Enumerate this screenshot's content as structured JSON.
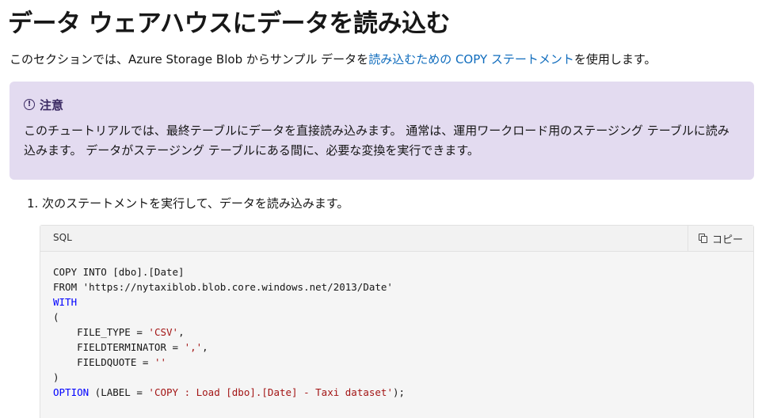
{
  "heading": "データ ウェアハウスにデータを読み込む",
  "intro": {
    "before_link": "このセクションでは、Azure Storage Blob からサンプル データを",
    "link": "読み込むための COPY ステートメント",
    "after_link": "を使用します。"
  },
  "note": {
    "icon": "info-circle-icon",
    "title": "注意",
    "body": "このチュートリアルでは、最終テーブルにデータを直接読み込みます。 通常は、運用ワークロード用のステージング テーブルに読み込みます。 データがステージング テーブルにある間に、必要な変換を実行できます。"
  },
  "step": {
    "number": "1.",
    "text": "次のステートメントを実行して、データを読み込みます。"
  },
  "code": {
    "language": "SQL",
    "copy_label": "コピー",
    "copy_icon": "copy-icon",
    "lines": [
      [
        {
          "t": "COPY INTO [dbo].[Date]",
          "c": ""
        }
      ],
      [
        {
          "t": "FROM 'https://nytaxiblob.blob.core.windows.net/2013/Date'",
          "c": ""
        }
      ],
      [
        {
          "t": "WITH",
          "c": "kw"
        }
      ],
      [
        {
          "t": "(",
          "c": ""
        }
      ],
      [
        {
          "t": "    FILE_TYPE = ",
          "c": ""
        },
        {
          "t": "'CSV'",
          "c": "str"
        },
        {
          "t": ",",
          "c": ""
        }
      ],
      [
        {
          "t": "    FIELDTERMINATOR = ",
          "c": ""
        },
        {
          "t": "','",
          "c": "str"
        },
        {
          "t": ",",
          "c": ""
        }
      ],
      [
        {
          "t": "    FIELDQUOTE = ",
          "c": ""
        },
        {
          "t": "''",
          "c": "str"
        }
      ],
      [
        {
          "t": ")",
          "c": ""
        }
      ],
      [
        {
          "t": "OPTION",
          "c": "kw"
        },
        {
          "t": " (LABEL = ",
          "c": ""
        },
        {
          "t": "'COPY : Load [dbo].[Date] - Taxi dataset'",
          "c": "str"
        },
        {
          "t": ");",
          "c": ""
        }
      ]
    ]
  },
  "colors": {
    "link": "#0f6cbd",
    "note_background": "#e3dbf0",
    "note_title": "#3b2a63",
    "code_keyword": "#0000ff",
    "code_string": "#a31515"
  }
}
